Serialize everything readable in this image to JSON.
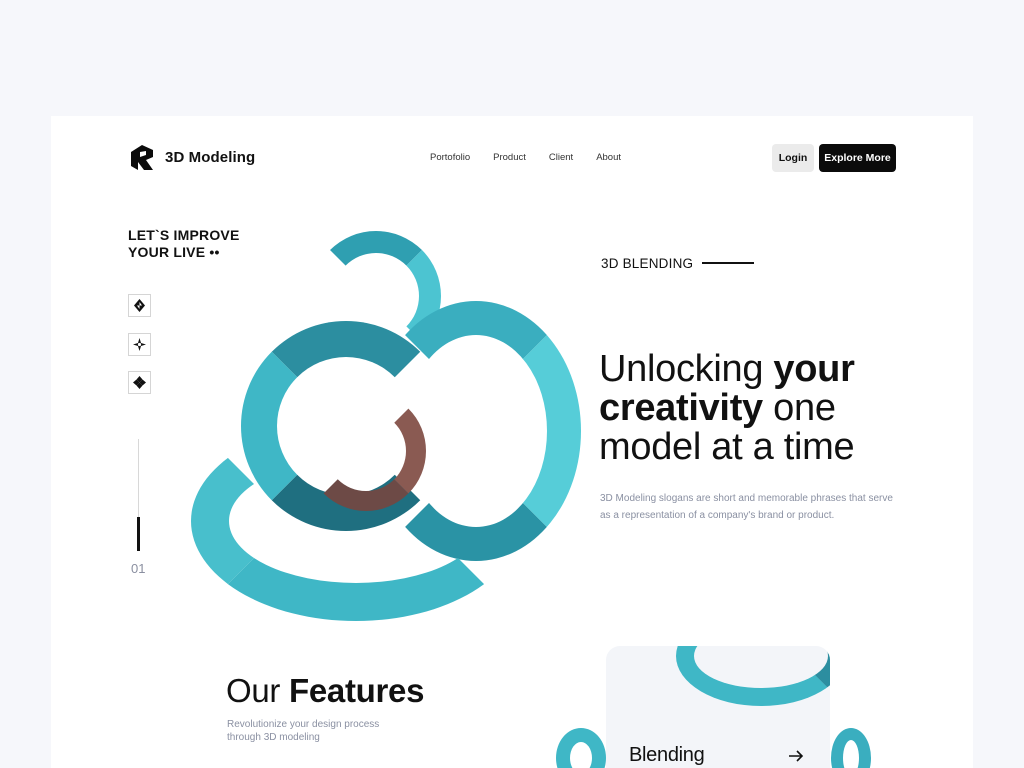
{
  "header": {
    "brand": "3D Modeling",
    "logo_icon": "brand-logo-icon",
    "nav": [
      "Portofolio",
      "Product",
      "Client",
      "About"
    ],
    "login_label": "Login",
    "explore_label": "Explore More"
  },
  "left": {
    "tagline_line1": "LET`S IMPROVE",
    "tagline_line2": "YOUR LIVE ••",
    "social_icons": [
      "diamond-icon",
      "sparkle-icon",
      "clover-icon"
    ],
    "slide_number": "01",
    "slide_progress": 0.3
  },
  "hero": {
    "eyebrow": "3D BLENDING",
    "headline_part1": "Unlocking ",
    "headline_bold1": "your creativity",
    "headline_part2": " one model at a time",
    "description": "3D Modeling slogans are short and memorable phrases that serve as a representation of a company's brand or product."
  },
  "features": {
    "title_regular": "Our ",
    "title_bold": "Features",
    "subtitle": "Revolutionize your design process through 3D modeling",
    "card_label": "Blending",
    "card_icon": "arrow-right-icon"
  },
  "colors": {
    "accent_teal": "#3fb7c6",
    "accent_copper": "#8a5a52",
    "dark": "#0b0b0b",
    "muted_text": "#8a90a2"
  }
}
